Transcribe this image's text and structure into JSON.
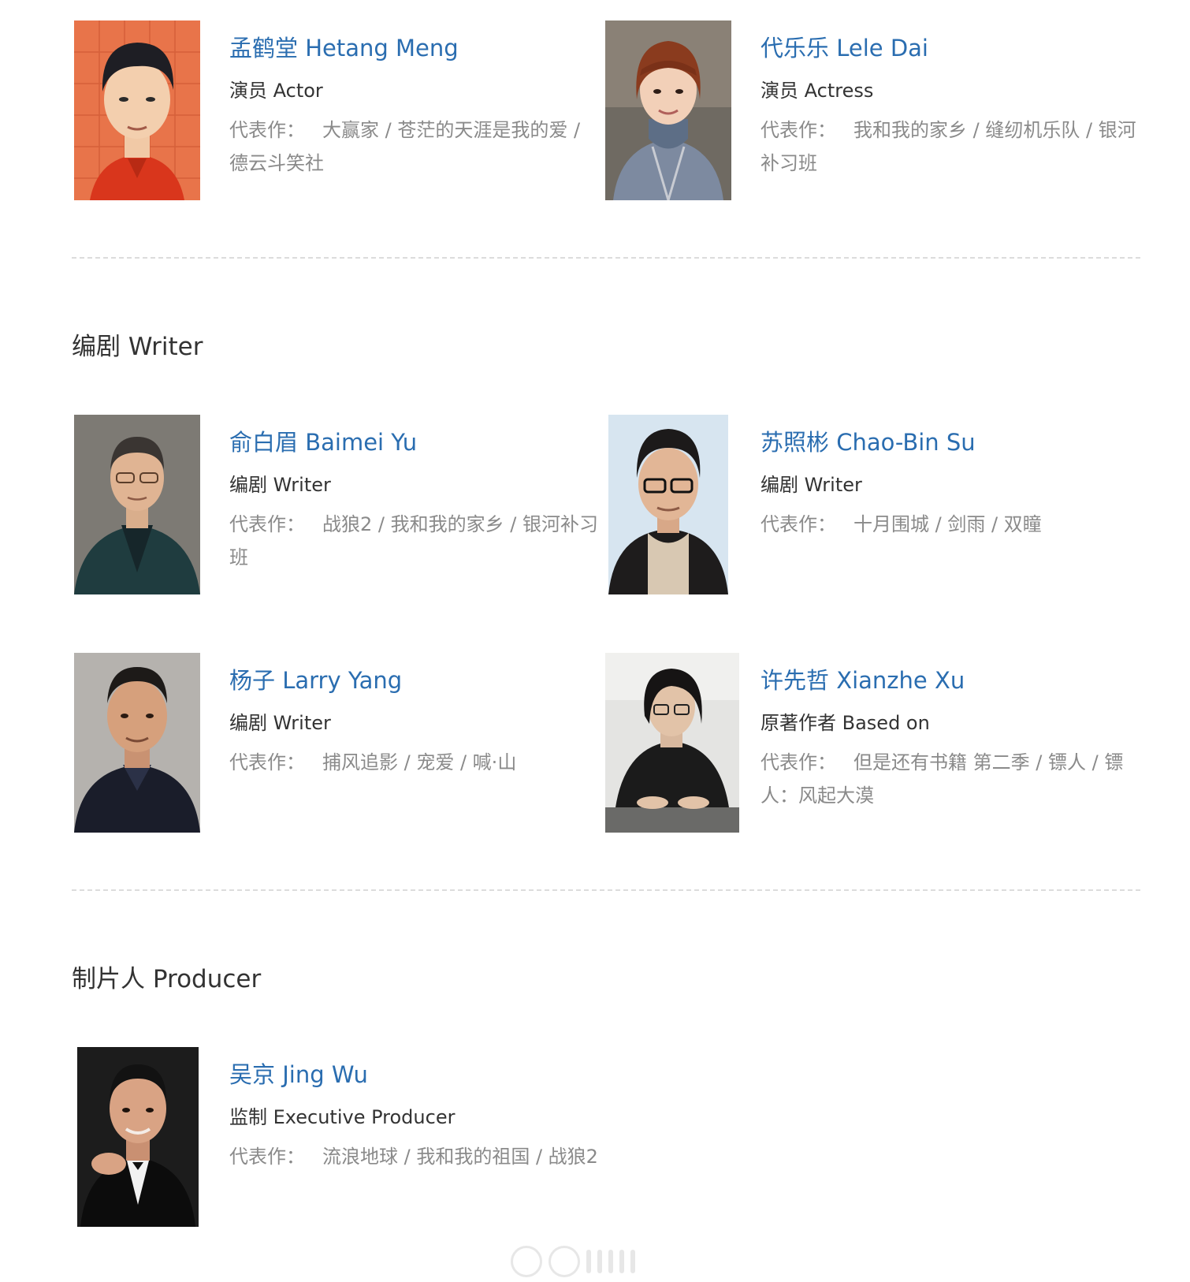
{
  "works_label": "代表作：",
  "sections": {
    "writer": {
      "title": "编剧 Writer"
    },
    "producer": {
      "title": "制片人 Producer"
    }
  },
  "people": {
    "meng": {
      "name": "孟鹤堂 Hetang Meng",
      "role": "演员 Actor",
      "works": "大赢家 / 苍茫的天涯是我的爱 / 德云斗笑社"
    },
    "dai": {
      "name": "代乐乐 Lele Dai",
      "role": "演员 Actress",
      "works": "我和我的家乡 / 缝纫机乐队 / 银河补习班"
    },
    "yu": {
      "name": "俞白眉 Baimei Yu",
      "role": "编剧 Writer",
      "works": "战狼2 / 我和我的家乡 / 银河补习班"
    },
    "su": {
      "name": "苏照彬 Chao-Bin Su",
      "role": "编剧 Writer",
      "works": "十月围城 / 剑雨 / 双瞳"
    },
    "yang": {
      "name": "杨子 Larry Yang",
      "role": "编剧 Writer",
      "works": "捕风追影 / 宠爱 / 喊·山"
    },
    "xu": {
      "name": "许先哲 Xianzhe Xu",
      "role": "原著作者 Based on",
      "works": "但是还有书籍 第二季 / 镖人 / 镖人：风起大漠"
    },
    "wu": {
      "name": "吴京 Jing Wu",
      "role": "监制 Executive Producer",
      "works": "流浪地球 / 我和我的祖国 / 战狼2"
    }
  }
}
